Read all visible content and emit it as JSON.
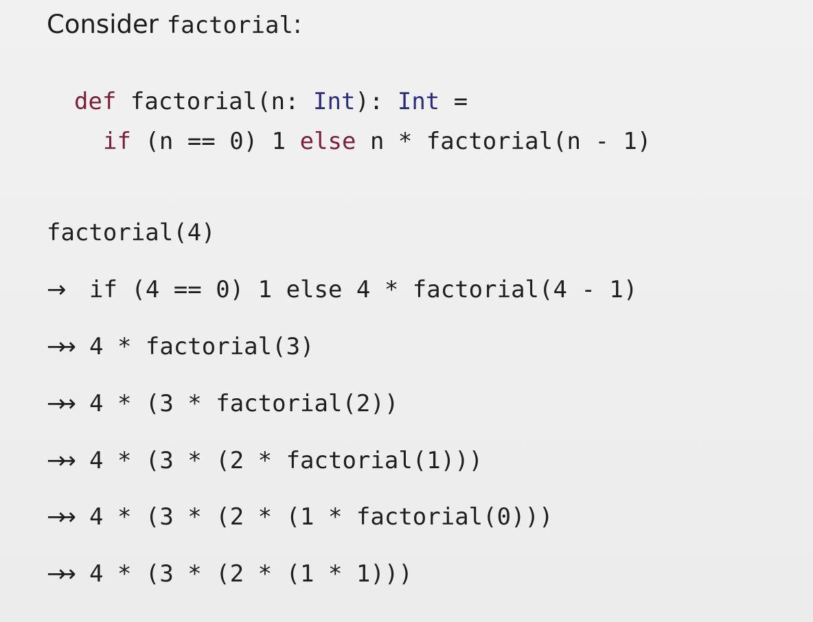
{
  "heading": {
    "prefix": "Consider ",
    "code": "factorial",
    "suffix": ":"
  },
  "definition": {
    "line1": {
      "kw_def": "def",
      "name": " factorial(n: ",
      "type1": "Int",
      "mid": "): ",
      "type2": "Int",
      "end": " ="
    },
    "line2": {
      "kw_if": "if",
      "cond": " (n == 0) 1 ",
      "kw_else": "else",
      "rest": " n * factorial(n - 1)"
    }
  },
  "evaluation": {
    "start": "factorial(4)",
    "steps": [
      {
        "arrow": "→",
        "text": "if (4 == 0) 1 else 4 * factorial(4 - 1)"
      },
      {
        "arrow": "→→",
        "text": "4 * factorial(3)"
      },
      {
        "arrow": "→→",
        "text": "4 * (3 * factorial(2))"
      },
      {
        "arrow": "→→",
        "text": "4 * (3 * (2 * factorial(1)))"
      },
      {
        "arrow": "→→",
        "text": "4 * (3 * (2 * (1 * factorial(0)))"
      },
      {
        "arrow": "→→",
        "text": "4 * (3 * (2 * (1 * 1)))"
      }
    ]
  }
}
